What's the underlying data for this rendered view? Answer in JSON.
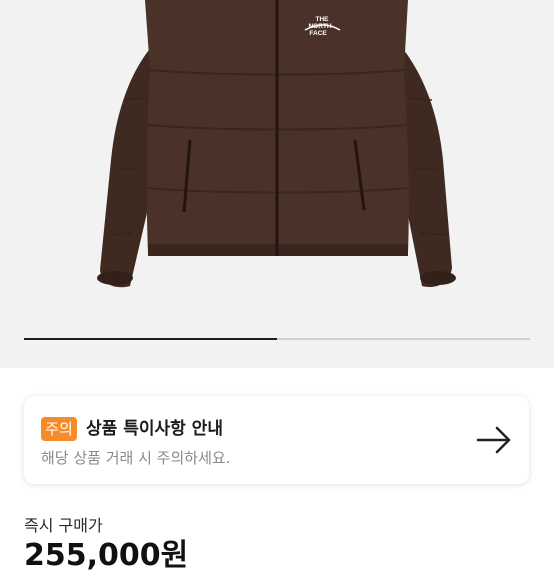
{
  "product_image": {
    "logo_text": [
      "THE",
      "NORTH",
      "FACE"
    ],
    "alt": "brown puffer jacket",
    "carousel_progress": 0.5
  },
  "notice": {
    "badge": "주의",
    "title": "상품 특이사항 안내",
    "subtitle": "해당 상품 거래 시 주의하세요.",
    "arrow_icon": "arrow-right-icon"
  },
  "purchase": {
    "label": "즉시 구매가",
    "price": "255,000원"
  },
  "colors": {
    "badge": "#f58c29",
    "jacket": "#4a3229",
    "background": "#f2f2f2"
  }
}
